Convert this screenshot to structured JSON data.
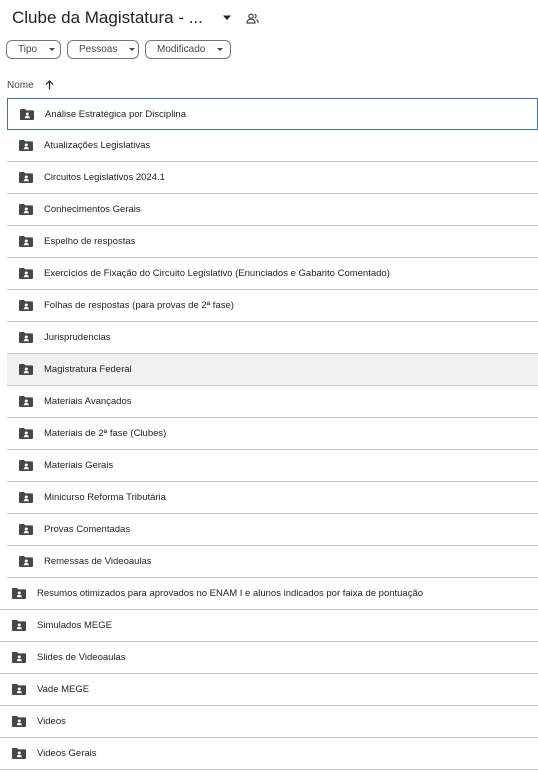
{
  "header": {
    "title": "Clube da Magistatura - ...",
    "title_caret_icon": "caret-down-icon",
    "share_icon": "people-icon"
  },
  "filters": [
    {
      "label": "Tipo",
      "icon": "caret-down-icon"
    },
    {
      "label": "Pessoas",
      "icon": "caret-down-icon"
    },
    {
      "label": "Modificado",
      "icon": "caret-down-icon"
    }
  ],
  "column_header": {
    "label": "Nome",
    "sort_icon": "arrow-up-icon"
  },
  "folder_icon": "shared-folder-icon",
  "colors": {
    "selection_border": "#3d6fc4",
    "hover_bg": "#f0f1f0",
    "divider": "#c7c7c7",
    "folder": "#444746"
  },
  "rows": [
    {
      "label": "Análise Estratégica por Disciplina",
      "selected": true
    },
    {
      "label": "Atualizações Legislativas"
    },
    {
      "label": "Circuitos Legislativos 2024.1"
    },
    {
      "label": "Conhecimentos Gerais"
    },
    {
      "label": "Espelho de respostas"
    },
    {
      "label": "Exercícios de Fixação do Circuito Legislativo (Enunciados e Gabarito Comentado)"
    },
    {
      "label": "Folhas de respostas (para provas de 2ª fase)"
    },
    {
      "label": "Jurisprudencias"
    },
    {
      "label": "Magistratura Federal",
      "hover": true
    },
    {
      "label": "Materiais Avançados"
    },
    {
      "label": "Materiais de 2ª fase (Clubes)"
    },
    {
      "label": "Materiais Gerais"
    },
    {
      "label": "Minicurso Reforma Tributária"
    },
    {
      "label": "Provas Comentadas"
    },
    {
      "label": "Remessas de Videoaulas"
    },
    {
      "label": "Resumos otimizados para aprovados no ENAM I e alunos indicados por faixa de pontuação"
    },
    {
      "label": "Simulados MEGE"
    },
    {
      "label": "Slides de Videoaulas"
    },
    {
      "label": "Vade MEGE"
    },
    {
      "label": "Videos"
    },
    {
      "label": "Videos Gerais"
    }
  ]
}
